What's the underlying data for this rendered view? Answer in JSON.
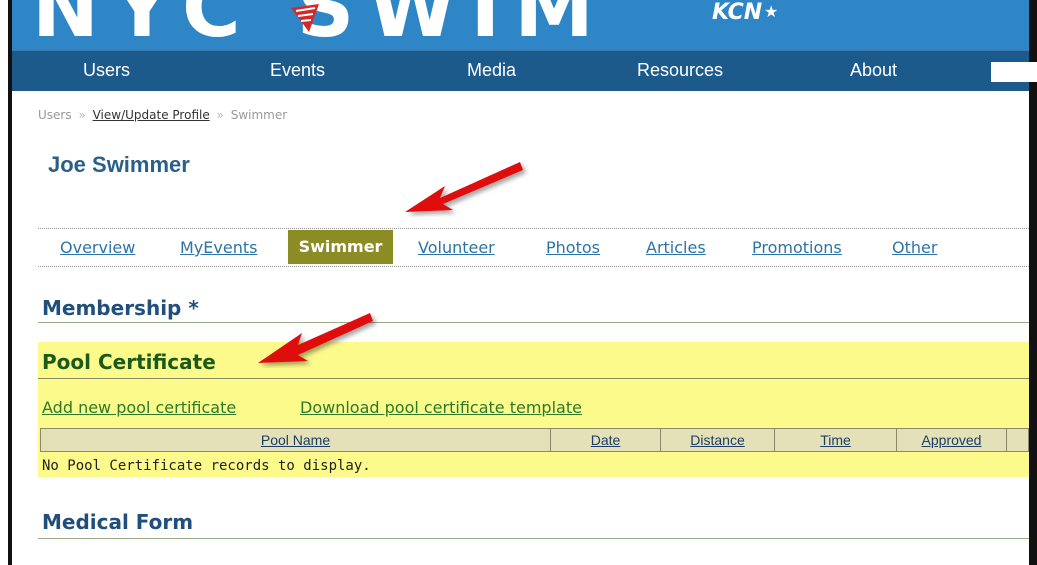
{
  "banner": {
    "logo_text": "NYC SWIM",
    "logo_sub": "KCN",
    "logo_star": "★"
  },
  "nav": {
    "items": [
      "Users",
      "Events",
      "Media",
      "Resources",
      "About"
    ]
  },
  "breadcrumb": {
    "items": [
      "Users",
      "View/Update Profile",
      "Swimmer"
    ],
    "separator": "»"
  },
  "profile": {
    "name": "Joe Swimmer"
  },
  "tabs": {
    "items": [
      "Overview",
      "MyEvents",
      "Swimmer",
      "Volunteer",
      "Photos",
      "Articles",
      "Promotions",
      "Other"
    ],
    "active": "Swimmer"
  },
  "sections": {
    "membership": "Membership *",
    "pool_certificate": "Pool Certificate",
    "medical_form": "Medical Form"
  },
  "pool": {
    "add_link": "Add new pool certificate",
    "download_link": "Download pool certificate template",
    "columns": [
      "Pool Name",
      "Date",
      "Distance",
      "Time",
      "Approved"
    ],
    "empty_message": "No Pool Certificate records to display."
  },
  "colors": {
    "banner": "#2f86c6",
    "nav": "#1c5a8c",
    "active_tab": "#8c8c24",
    "highlight": "#fbfa8a",
    "arrow": "#e01010"
  }
}
